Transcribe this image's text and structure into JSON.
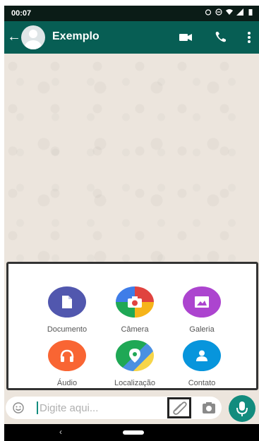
{
  "status_bar": {
    "time": "00:07"
  },
  "app_bar": {
    "title": "Exemplo"
  },
  "attachments": [
    {
      "label": "Documento",
      "color": "#5157ae",
      "icon": "document-icon"
    },
    {
      "label": "Câmera",
      "color": "#e0433f",
      "icon": "camera-icon"
    },
    {
      "label": "Galeria",
      "color": "#ac44cf",
      "icon": "gallery-icon"
    },
    {
      "label": "Áudio",
      "color": "#f96533",
      "icon": "headphones-icon"
    },
    {
      "label": "Localização",
      "color": "#1fa855",
      "icon": "location-icon"
    },
    {
      "label": "Contato",
      "color": "#0795dc",
      "icon": "contact-icon"
    }
  ],
  "input": {
    "placeholder": "Digite aqui..."
  },
  "colors": {
    "header": "#075e54",
    "accent": "#128c7e",
    "wallpaper": "#ece5dd"
  }
}
